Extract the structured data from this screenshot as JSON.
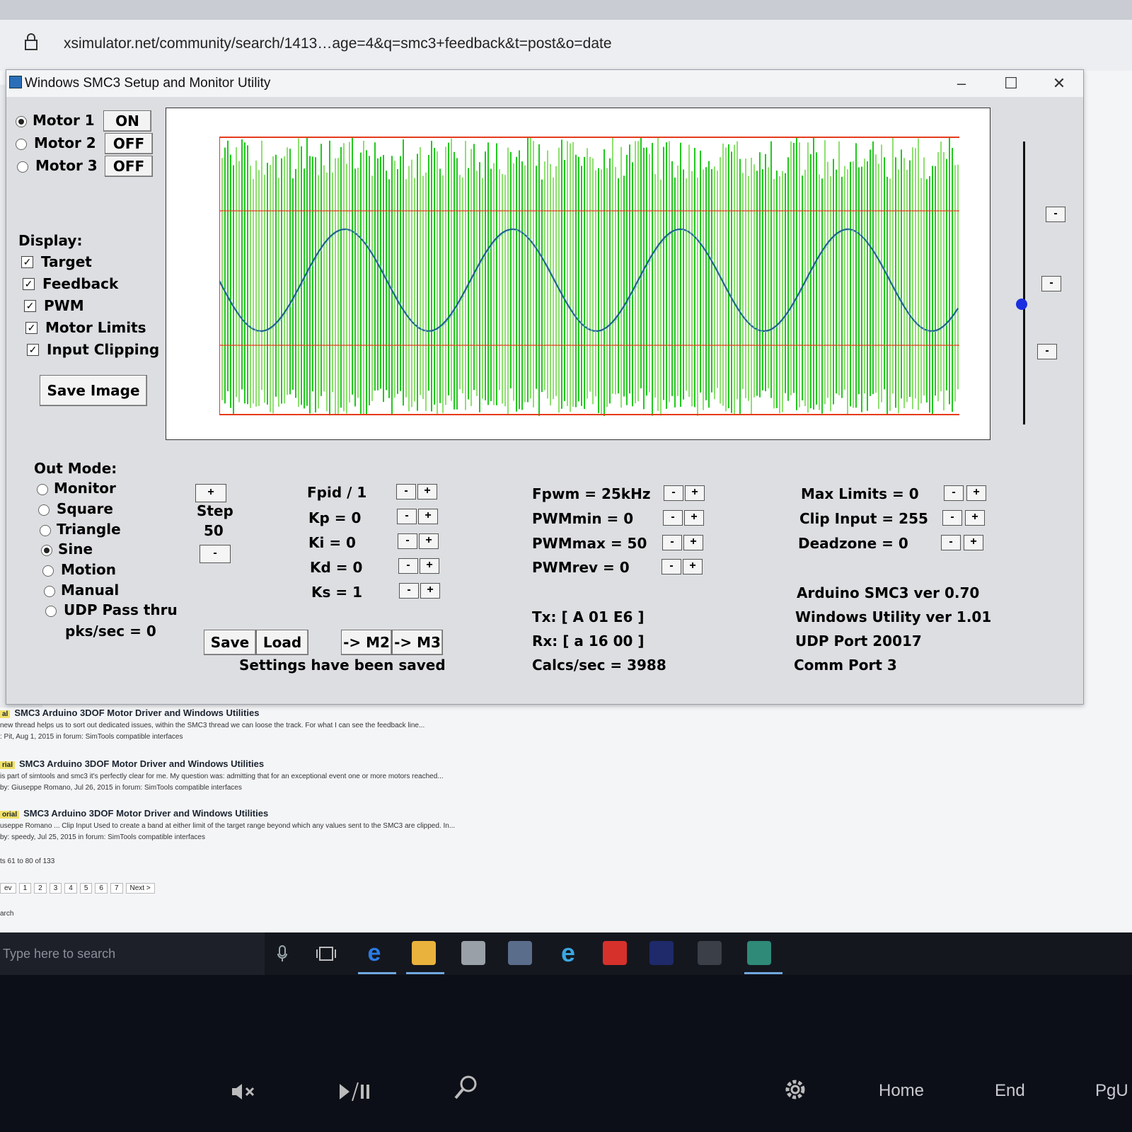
{
  "browser": {
    "url": "xsimulator.net/community/search/1413…age=4&q=smc3+feedback&t=post&o=date"
  },
  "window": {
    "title": "Windows SMC3 Setup and Monitor Utility",
    "minimize": "–",
    "maximize": "☐",
    "close": "✕"
  },
  "motors": [
    {
      "label": "Motor 1",
      "state": "ON",
      "selected": true
    },
    {
      "label": "Motor 2",
      "state": "OFF",
      "selected": false
    },
    {
      "label": "Motor 3",
      "state": "OFF",
      "selected": false
    }
  ],
  "display": {
    "heading": "Display:",
    "options": [
      "Target",
      "Feedback",
      "PWM",
      "Motor Limits",
      "Input Clipping"
    ],
    "save_image": "Save Image"
  },
  "out_mode": {
    "heading": "Out Mode:",
    "options": [
      "Monitor",
      "Square",
      "Triangle",
      "Sine",
      "Motion",
      "Manual",
      "UDP Pass thru"
    ],
    "selected": "Sine",
    "pks": "pks/sec = 0"
  },
  "step": {
    "plus": "+",
    "label": "Step",
    "value": "50",
    "minus": "-"
  },
  "pid": [
    "Fpid / 1",
    "Kp = 0",
    "Ki = 0",
    "Kd = 0",
    "Ks = 1"
  ],
  "pwm": [
    "Fpwm = 25kHz",
    "PWMmin = 0",
    "PWMmax = 50",
    "PWMrev = 0"
  ],
  "limits": [
    "Max Limits = 0",
    "Clip Input = 255",
    "Deadzone = 0"
  ],
  "buttons": {
    "save": "Save",
    "load": "Load",
    "to_m2": "-> M2",
    "to_m3": "-> M3",
    "minus": "-",
    "plus": "+"
  },
  "status": {
    "saved": "Settings have been saved",
    "tx": "Tx: [ A 01 E6 ]",
    "rx": "Rx: [ a 16 00 ]",
    "calcs": "Calcs/sec = 3988",
    "arduino": "Arduino SMC3 ver 0.70",
    "utility": "Windows Utility ver 1.01",
    "udp": "UDP Port 20017",
    "comm": "Comm Port 3"
  },
  "colors": {
    "sine": "#1f5f8b",
    "pwm": "#22c81f",
    "pwm_light": "#8ee070",
    "limit": "#e63a1a"
  },
  "results": [
    {
      "tag": "al",
      "title": "SMC3 Arduino 3DOF Motor Driver and Windows Utilities",
      "snippet": "new thread helps us to sort out dedicated issues, within the SMC3 thread we can loose the track. For what I can see the feedback line...",
      "meta": ": Pit, Aug 1, 2015 in forum: SimTools compatible interfaces"
    },
    {
      "tag": "rial",
      "title": "SMC3 Arduino 3DOF Motor Driver and Windows Utilities",
      "snippet": "is part of simtools and smc3 it's perfectly clear for me. My question was: admitting that for an exceptional event one or more motors reached...",
      "meta": "by: Giuseppe Romano, Jul 26, 2015 in forum: SimTools compatible interfaces"
    },
    {
      "tag": "orial",
      "title": "SMC3 Arduino 3DOF Motor Driver and Windows Utilities",
      "snippet": "useppe Romano ... Clip Input Used to create a band at either limit of the target range beyond which any values sent to the SMC3 are clipped. In...",
      "meta": "by: speedy, Jul 25, 2015 in forum: SimTools compatible interfaces"
    }
  ],
  "results_count": "ts 61 to 80 of 133",
  "pager": [
    "ev",
    "1",
    "2",
    "3",
    "4",
    "5",
    "6",
    "7",
    "Next >"
  ],
  "search_link": "arch",
  "taskbar": {
    "search_placeholder": "Type here to search"
  },
  "keys": [
    "Home",
    "End",
    "PgU"
  ]
}
